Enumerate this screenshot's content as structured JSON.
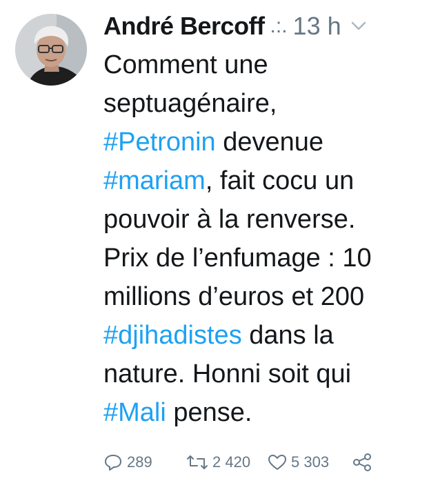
{
  "author": {
    "name": "André Bercoff",
    "handle_ellipsis": ".:.",
    "time": "13 h"
  },
  "tweet": {
    "line1": "Comment une",
    "line2": "septuagénaire,",
    "line3_tag": "#Petronin",
    "line3_rest": " devenue",
    "line4_tag": "#mariam",
    "line4_rest": ", fait cocu un",
    "line5": "pouvoir à la renverse.",
    "line6": "Prix de l’enfumage : 10",
    "line7": "millions d’euros et 200",
    "line8_tag": "#djihadistes",
    "line8_rest": " dans la",
    "line9": "nature. Honni soit qui",
    "line10_tag": "#Mali",
    "line10_rest": " pense."
  },
  "stats": {
    "replies": "289",
    "retweets": "2 420",
    "likes": "5 303"
  },
  "colors": {
    "hashtag": "#1da1f2",
    "muted": "#657786",
    "text": "#14171a"
  },
  "icons": [
    "chevron-down-icon",
    "reply-icon",
    "retweet-icon",
    "like-icon",
    "share-icon"
  ]
}
